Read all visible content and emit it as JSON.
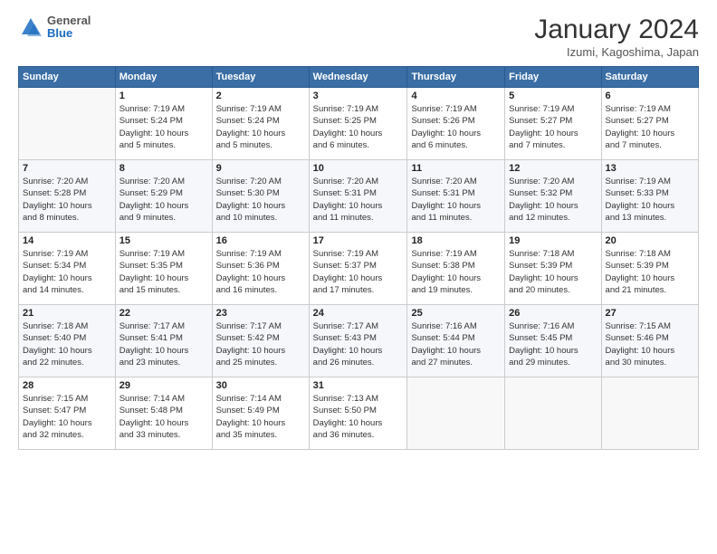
{
  "header": {
    "logo_general": "General",
    "logo_blue": "Blue",
    "month_title": "January 2024",
    "location": "Izumi, Kagoshima, Japan"
  },
  "weekdays": [
    "Sunday",
    "Monday",
    "Tuesday",
    "Wednesday",
    "Thursday",
    "Friday",
    "Saturday"
  ],
  "weeks": [
    [
      {
        "day": "",
        "info": ""
      },
      {
        "day": "1",
        "info": "Sunrise: 7:19 AM\nSunset: 5:24 PM\nDaylight: 10 hours\nand 5 minutes."
      },
      {
        "day": "2",
        "info": "Sunrise: 7:19 AM\nSunset: 5:24 PM\nDaylight: 10 hours\nand 5 minutes."
      },
      {
        "day": "3",
        "info": "Sunrise: 7:19 AM\nSunset: 5:25 PM\nDaylight: 10 hours\nand 6 minutes."
      },
      {
        "day": "4",
        "info": "Sunrise: 7:19 AM\nSunset: 5:26 PM\nDaylight: 10 hours\nand 6 minutes."
      },
      {
        "day": "5",
        "info": "Sunrise: 7:19 AM\nSunset: 5:27 PM\nDaylight: 10 hours\nand 7 minutes."
      },
      {
        "day": "6",
        "info": "Sunrise: 7:19 AM\nSunset: 5:27 PM\nDaylight: 10 hours\nand 7 minutes."
      }
    ],
    [
      {
        "day": "7",
        "info": "Sunrise: 7:20 AM\nSunset: 5:28 PM\nDaylight: 10 hours\nand 8 minutes."
      },
      {
        "day": "8",
        "info": "Sunrise: 7:20 AM\nSunset: 5:29 PM\nDaylight: 10 hours\nand 9 minutes."
      },
      {
        "day": "9",
        "info": "Sunrise: 7:20 AM\nSunset: 5:30 PM\nDaylight: 10 hours\nand 10 minutes."
      },
      {
        "day": "10",
        "info": "Sunrise: 7:20 AM\nSunset: 5:31 PM\nDaylight: 10 hours\nand 11 minutes."
      },
      {
        "day": "11",
        "info": "Sunrise: 7:20 AM\nSunset: 5:31 PM\nDaylight: 10 hours\nand 11 minutes."
      },
      {
        "day": "12",
        "info": "Sunrise: 7:20 AM\nSunset: 5:32 PM\nDaylight: 10 hours\nand 12 minutes."
      },
      {
        "day": "13",
        "info": "Sunrise: 7:19 AM\nSunset: 5:33 PM\nDaylight: 10 hours\nand 13 minutes."
      }
    ],
    [
      {
        "day": "14",
        "info": "Sunrise: 7:19 AM\nSunset: 5:34 PM\nDaylight: 10 hours\nand 14 minutes."
      },
      {
        "day": "15",
        "info": "Sunrise: 7:19 AM\nSunset: 5:35 PM\nDaylight: 10 hours\nand 15 minutes."
      },
      {
        "day": "16",
        "info": "Sunrise: 7:19 AM\nSunset: 5:36 PM\nDaylight: 10 hours\nand 16 minutes."
      },
      {
        "day": "17",
        "info": "Sunrise: 7:19 AM\nSunset: 5:37 PM\nDaylight: 10 hours\nand 17 minutes."
      },
      {
        "day": "18",
        "info": "Sunrise: 7:19 AM\nSunset: 5:38 PM\nDaylight: 10 hours\nand 19 minutes."
      },
      {
        "day": "19",
        "info": "Sunrise: 7:18 AM\nSunset: 5:39 PM\nDaylight: 10 hours\nand 20 minutes."
      },
      {
        "day": "20",
        "info": "Sunrise: 7:18 AM\nSunset: 5:39 PM\nDaylight: 10 hours\nand 21 minutes."
      }
    ],
    [
      {
        "day": "21",
        "info": "Sunrise: 7:18 AM\nSunset: 5:40 PM\nDaylight: 10 hours\nand 22 minutes."
      },
      {
        "day": "22",
        "info": "Sunrise: 7:17 AM\nSunset: 5:41 PM\nDaylight: 10 hours\nand 23 minutes."
      },
      {
        "day": "23",
        "info": "Sunrise: 7:17 AM\nSunset: 5:42 PM\nDaylight: 10 hours\nand 25 minutes."
      },
      {
        "day": "24",
        "info": "Sunrise: 7:17 AM\nSunset: 5:43 PM\nDaylight: 10 hours\nand 26 minutes."
      },
      {
        "day": "25",
        "info": "Sunrise: 7:16 AM\nSunset: 5:44 PM\nDaylight: 10 hours\nand 27 minutes."
      },
      {
        "day": "26",
        "info": "Sunrise: 7:16 AM\nSunset: 5:45 PM\nDaylight: 10 hours\nand 29 minutes."
      },
      {
        "day": "27",
        "info": "Sunrise: 7:15 AM\nSunset: 5:46 PM\nDaylight: 10 hours\nand 30 minutes."
      }
    ],
    [
      {
        "day": "28",
        "info": "Sunrise: 7:15 AM\nSunset: 5:47 PM\nDaylight: 10 hours\nand 32 minutes."
      },
      {
        "day": "29",
        "info": "Sunrise: 7:14 AM\nSunset: 5:48 PM\nDaylight: 10 hours\nand 33 minutes."
      },
      {
        "day": "30",
        "info": "Sunrise: 7:14 AM\nSunset: 5:49 PM\nDaylight: 10 hours\nand 35 minutes."
      },
      {
        "day": "31",
        "info": "Sunrise: 7:13 AM\nSunset: 5:50 PM\nDaylight: 10 hours\nand 36 minutes."
      },
      {
        "day": "",
        "info": ""
      },
      {
        "day": "",
        "info": ""
      },
      {
        "day": "",
        "info": ""
      }
    ]
  ]
}
